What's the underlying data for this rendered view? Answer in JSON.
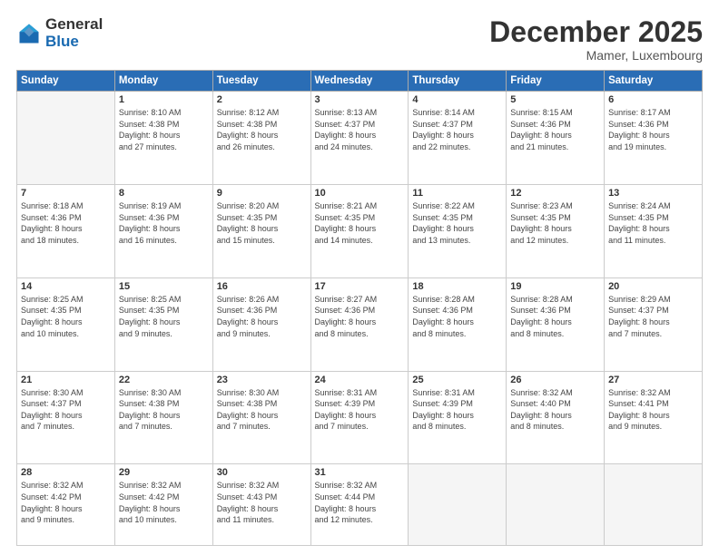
{
  "logo": {
    "general": "General",
    "blue": "Blue"
  },
  "header": {
    "month": "December 2025",
    "location": "Mamer, Luxembourg"
  },
  "weekdays": [
    "Sunday",
    "Monday",
    "Tuesday",
    "Wednesday",
    "Thursday",
    "Friday",
    "Saturday"
  ],
  "weeks": [
    [
      {
        "day": "",
        "info": ""
      },
      {
        "day": "1",
        "info": "Sunrise: 8:10 AM\nSunset: 4:38 PM\nDaylight: 8 hours\nand 27 minutes."
      },
      {
        "day": "2",
        "info": "Sunrise: 8:12 AM\nSunset: 4:38 PM\nDaylight: 8 hours\nand 26 minutes."
      },
      {
        "day": "3",
        "info": "Sunrise: 8:13 AM\nSunset: 4:37 PM\nDaylight: 8 hours\nand 24 minutes."
      },
      {
        "day": "4",
        "info": "Sunrise: 8:14 AM\nSunset: 4:37 PM\nDaylight: 8 hours\nand 22 minutes."
      },
      {
        "day": "5",
        "info": "Sunrise: 8:15 AM\nSunset: 4:36 PM\nDaylight: 8 hours\nand 21 minutes."
      },
      {
        "day": "6",
        "info": "Sunrise: 8:17 AM\nSunset: 4:36 PM\nDaylight: 8 hours\nand 19 minutes."
      }
    ],
    [
      {
        "day": "7",
        "info": "Sunrise: 8:18 AM\nSunset: 4:36 PM\nDaylight: 8 hours\nand 18 minutes."
      },
      {
        "day": "8",
        "info": "Sunrise: 8:19 AM\nSunset: 4:36 PM\nDaylight: 8 hours\nand 16 minutes."
      },
      {
        "day": "9",
        "info": "Sunrise: 8:20 AM\nSunset: 4:35 PM\nDaylight: 8 hours\nand 15 minutes."
      },
      {
        "day": "10",
        "info": "Sunrise: 8:21 AM\nSunset: 4:35 PM\nDaylight: 8 hours\nand 14 minutes."
      },
      {
        "day": "11",
        "info": "Sunrise: 8:22 AM\nSunset: 4:35 PM\nDaylight: 8 hours\nand 13 minutes."
      },
      {
        "day": "12",
        "info": "Sunrise: 8:23 AM\nSunset: 4:35 PM\nDaylight: 8 hours\nand 12 minutes."
      },
      {
        "day": "13",
        "info": "Sunrise: 8:24 AM\nSunset: 4:35 PM\nDaylight: 8 hours\nand 11 minutes."
      }
    ],
    [
      {
        "day": "14",
        "info": "Sunrise: 8:25 AM\nSunset: 4:35 PM\nDaylight: 8 hours\nand 10 minutes."
      },
      {
        "day": "15",
        "info": "Sunrise: 8:25 AM\nSunset: 4:35 PM\nDaylight: 8 hours\nand 9 minutes."
      },
      {
        "day": "16",
        "info": "Sunrise: 8:26 AM\nSunset: 4:36 PM\nDaylight: 8 hours\nand 9 minutes."
      },
      {
        "day": "17",
        "info": "Sunrise: 8:27 AM\nSunset: 4:36 PM\nDaylight: 8 hours\nand 8 minutes."
      },
      {
        "day": "18",
        "info": "Sunrise: 8:28 AM\nSunset: 4:36 PM\nDaylight: 8 hours\nand 8 minutes."
      },
      {
        "day": "19",
        "info": "Sunrise: 8:28 AM\nSunset: 4:36 PM\nDaylight: 8 hours\nand 8 minutes."
      },
      {
        "day": "20",
        "info": "Sunrise: 8:29 AM\nSunset: 4:37 PM\nDaylight: 8 hours\nand 7 minutes."
      }
    ],
    [
      {
        "day": "21",
        "info": "Sunrise: 8:30 AM\nSunset: 4:37 PM\nDaylight: 8 hours\nand 7 minutes."
      },
      {
        "day": "22",
        "info": "Sunrise: 8:30 AM\nSunset: 4:38 PM\nDaylight: 8 hours\nand 7 minutes."
      },
      {
        "day": "23",
        "info": "Sunrise: 8:30 AM\nSunset: 4:38 PM\nDaylight: 8 hours\nand 7 minutes."
      },
      {
        "day": "24",
        "info": "Sunrise: 8:31 AM\nSunset: 4:39 PM\nDaylight: 8 hours\nand 7 minutes."
      },
      {
        "day": "25",
        "info": "Sunrise: 8:31 AM\nSunset: 4:39 PM\nDaylight: 8 hours\nand 8 minutes."
      },
      {
        "day": "26",
        "info": "Sunrise: 8:32 AM\nSunset: 4:40 PM\nDaylight: 8 hours\nand 8 minutes."
      },
      {
        "day": "27",
        "info": "Sunrise: 8:32 AM\nSunset: 4:41 PM\nDaylight: 8 hours\nand 9 minutes."
      }
    ],
    [
      {
        "day": "28",
        "info": "Sunrise: 8:32 AM\nSunset: 4:42 PM\nDaylight: 8 hours\nand 9 minutes."
      },
      {
        "day": "29",
        "info": "Sunrise: 8:32 AM\nSunset: 4:42 PM\nDaylight: 8 hours\nand 10 minutes."
      },
      {
        "day": "30",
        "info": "Sunrise: 8:32 AM\nSunset: 4:43 PM\nDaylight: 8 hours\nand 11 minutes."
      },
      {
        "day": "31",
        "info": "Sunrise: 8:32 AM\nSunset: 4:44 PM\nDaylight: 8 hours\nand 12 minutes."
      },
      {
        "day": "",
        "info": ""
      },
      {
        "day": "",
        "info": ""
      },
      {
        "day": "",
        "info": ""
      }
    ]
  ]
}
